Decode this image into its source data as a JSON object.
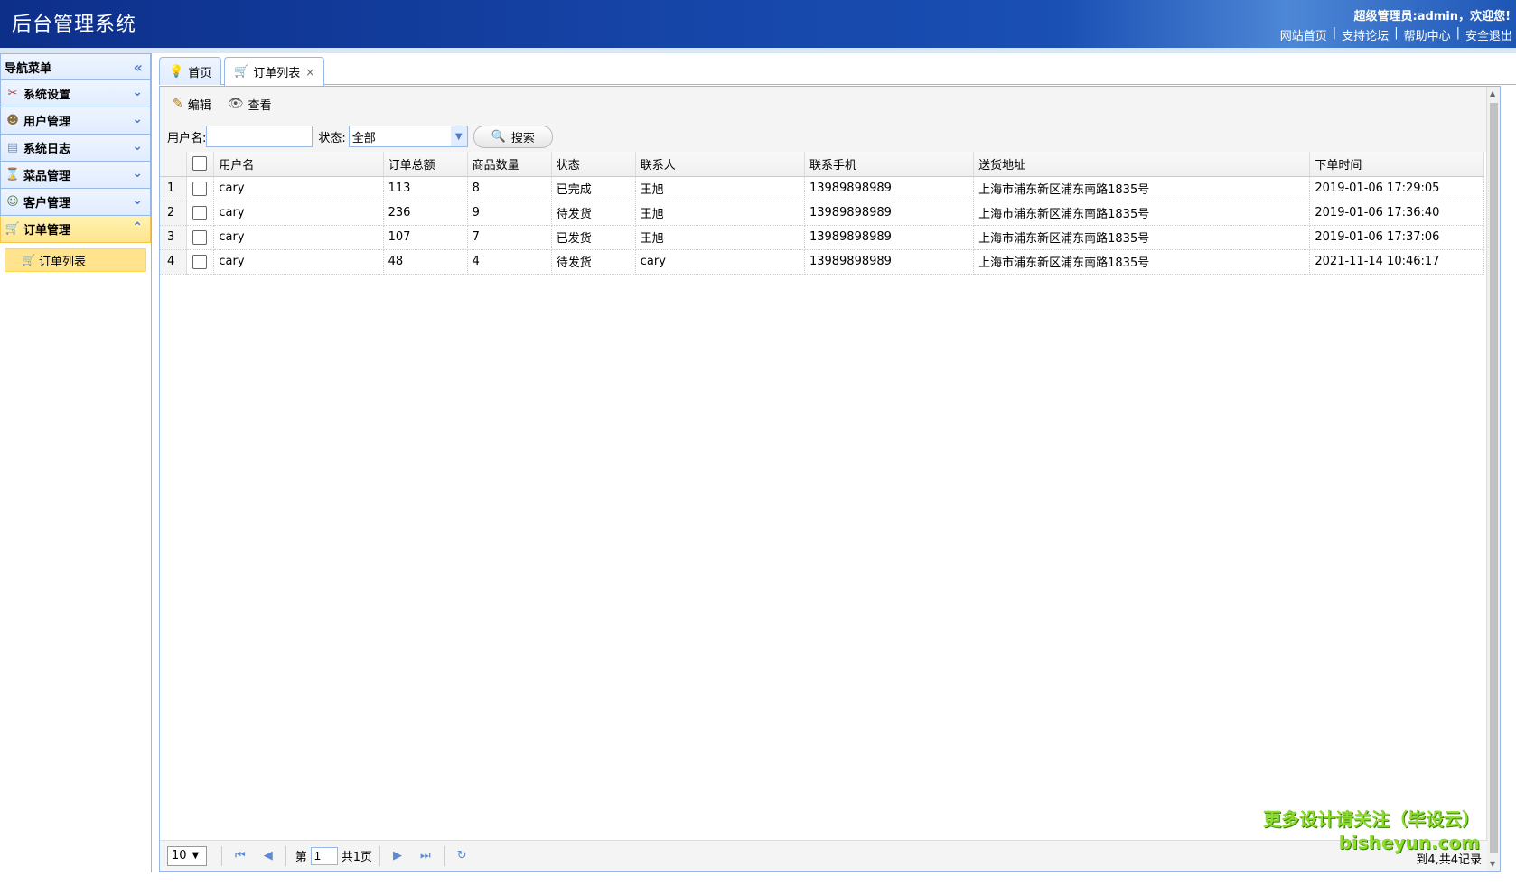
{
  "header": {
    "title": "后台管理系统",
    "welcome": "超级管理员:admin，欢迎您!",
    "links": [
      "网站首页",
      "支持论坛",
      "帮助中心",
      "安全退出"
    ]
  },
  "sidebar": {
    "title": "导航菜单",
    "items": [
      {
        "label": "系统设置",
        "icon": "tools-icon"
      },
      {
        "label": "用户管理",
        "icon": "user-icon"
      },
      {
        "label": "系统日志",
        "icon": "log-icon"
      },
      {
        "label": "菜品管理",
        "icon": "dish-icon"
      },
      {
        "label": "客户管理",
        "icon": "customer-icon"
      },
      {
        "label": "订单管理",
        "icon": "cart-icon"
      }
    ],
    "sub_item": "订单列表"
  },
  "tabs": [
    {
      "label": "首页"
    },
    {
      "label": "订单列表"
    }
  ],
  "toolbar": {
    "edit": "编辑",
    "view": "查看"
  },
  "filter": {
    "username_label": "用户名:",
    "username_value": "",
    "status_label": "状态:",
    "status_value": "全部",
    "search_label": "搜索"
  },
  "table": {
    "headers": [
      "用户名",
      "订单总额",
      "商品数量",
      "状态",
      "联系人",
      "联系手机",
      "送货地址",
      "下单时间"
    ],
    "rows": [
      [
        "1",
        "cary",
        "113",
        "8",
        "已完成",
        "王旭",
        "13989898989",
        "上海市浦东新区浦东南路1835号",
        "2019-01-06 17:29:05"
      ],
      [
        "2",
        "cary",
        "236",
        "9",
        "待发货",
        "王旭",
        "13989898989",
        "上海市浦东新区浦东南路1835号",
        "2019-01-06 17:36:40"
      ],
      [
        "3",
        "cary",
        "107",
        "7",
        "已发货",
        "王旭",
        "13989898989",
        "上海市浦东新区浦东南路1835号",
        "2019-01-06 17:37:06"
      ],
      [
        "4",
        "cary",
        "48",
        "4",
        "待发货",
        "cary",
        "13989898989",
        "上海市浦东新区浦东南路1835号",
        "2021-11-14 10:46:17"
      ]
    ]
  },
  "pager": {
    "page_size": "10",
    "page_prefix": "第",
    "page_value": "1",
    "page_total": "共1页",
    "info": "到4,共4记录"
  },
  "watermark": {
    "line1": "更多设计请关注（毕设云）",
    "line2": "bisheyun.com"
  }
}
